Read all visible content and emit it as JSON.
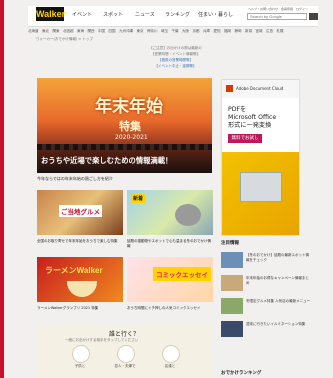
{
  "header": {
    "logo": "Walker",
    "nav": [
      "イベント",
      "スポット",
      "ニュース",
      "ランキング",
      "住まい・暮らし"
    ],
    "search_placeholder": "Search by Google",
    "top_links": "ヘルプ・お問い合わせ　会員登録　ログイン"
  },
  "regions": "北海道　東北　関東　北信越　東海　関西　中国　四国　九州沖縄　東京　神奈川　埼玉　千葉　大阪　京都　兵庫　愛知　福岡　静岡　新潟　宮城　広島　札幌",
  "breadcrumb": "ウォーカー(おでかけ情報) > トップ",
  "notice": {
    "line1": "【ご注意】お出かけの際は最新の",
    "line2": "【営業時間・イベント情報等】",
    "link1": "【施設の営業時間等】",
    "link2": "【イベント中止・延期等】"
  },
  "hero": {
    "title": "年末年始",
    "subtitle": "特集",
    "year": "2020-2021",
    "caption": "おうちや近場で楽しむための情報満載！",
    "description": "今年ならではの年末年始の過ごし方を紹介"
  },
  "cards": [
    {
      "label": "ご当地グルメ",
      "description": "全国のお取り寄せで年末年始をおうちで楽しむ特集"
    },
    {
      "label": "新着",
      "description": "話題の猫動物やスポットで心も温まる冬のおでかけ情報"
    },
    {
      "label": "ラーメンWalker",
      "description": "ラーメンWalkerグランプリ 2021 特集"
    },
    {
      "label": "コミックエッセイ",
      "description": "おうち時間にイチ押しの人気コミックエッセイ"
    }
  ],
  "ad": {
    "brand": "Adobe Document Cloud",
    "headline1": "PDFを",
    "headline2": "Microsoft Office",
    "headline3": "形式に一発変換",
    "button": "無料でお試し"
  },
  "sidebar": {
    "heading": "注目情報",
    "items": [
      "【冬のおでかけ】話題の最新スポット情報をチェック",
      "年末年始のお得なキャンペーン情報まとめ",
      "冬限定グルメ特集 人気店の最新メニュー",
      "週末に行きたいイルミネーション特集"
    ]
  },
  "quiz": {
    "question": "誰と行く？",
    "subtitle": "一緒にお出かけする相手をタップしてください",
    "options": [
      "子供と",
      "恋人・夫婦で",
      "友達と"
    ]
  },
  "bottom_heading": "おでかけランキング",
  "colors": {
    "brand_accent": "#c8102e",
    "logo_bg": "#111111",
    "logo_fg": "#ffd200",
    "ad_button": "#c2185b"
  }
}
